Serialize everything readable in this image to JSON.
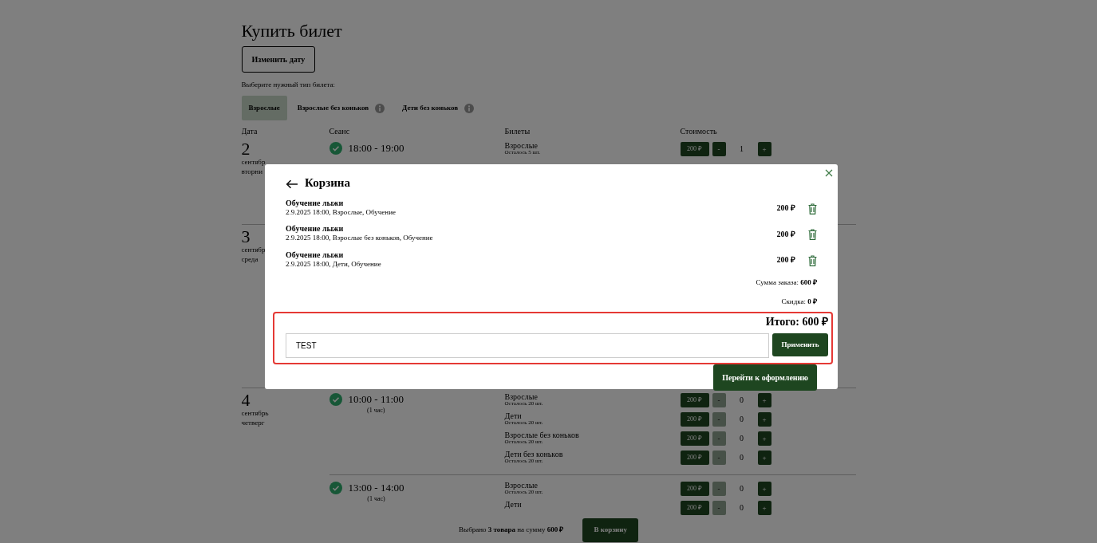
{
  "page": {
    "title": "Купить билет",
    "change_date_button": "Изменить дату",
    "instruction": "Выберите нужный тип билета:",
    "tabs": [
      {
        "label": "Взрослые",
        "selected": true,
        "info": false
      },
      {
        "label": "Взрослые без коньков",
        "selected": false,
        "info": true
      },
      {
        "label": "Дети без коньков",
        "selected": false,
        "info": true
      }
    ],
    "columns": [
      "Дата",
      "Сеанс",
      "Билеты",
      "Стоимость"
    ],
    "days": [
      {
        "day": "2",
        "month": "сентябр",
        "weekday": "вторни",
        "sessions": [
          {
            "time": "18:00 - 19:00",
            "tickets": [
              {
                "name": "Взрослые",
                "remaining": "Осталось 5 шт.",
                "price": "200 ₽",
                "minus": "-",
                "quantity": "1",
                "plus": "+",
                "minus_disabled": false
              }
            ]
          }
        ]
      },
      {
        "day": "3",
        "month": "сентябр",
        "weekday": "среда"
      },
      {
        "day": "4",
        "month": "сентябрь",
        "weekday": "четверг",
        "sessions": [
          {
            "time": "10:00 - 11:00",
            "duration": "(1 час)",
            "tickets": [
              {
                "name": "Взрослые",
                "remaining": "Осталось 20 шт.",
                "price": "200 ₽",
                "minus": "-",
                "quantity": "0",
                "plus": "+",
                "minus_disabled": true
              },
              {
                "name": "Дети",
                "remaining": "Осталось 20 шт.",
                "price": "200 ₽",
                "minus": "-",
                "quantity": "0",
                "plus": "+",
                "minus_disabled": true
              },
              {
                "name": "Взрослые без коньков",
                "remaining": "Осталось 20 шт.",
                "price": "200 ₽",
                "minus": "-",
                "quantity": "0",
                "plus": "+",
                "minus_disabled": true
              },
              {
                "name": "Дети без коньков",
                "remaining": "Осталось 20 шт.",
                "price": "200 ₽",
                "minus": "-",
                "quantity": "0",
                "plus": "+",
                "minus_disabled": true
              }
            ]
          },
          {
            "time": "13:00 - 14:00",
            "duration": "(1 час)",
            "tickets": [
              {
                "name": "Взрослые",
                "remaining": "Осталось 20 шт.",
                "price": "200 ₽",
                "minus": "-",
                "quantity": "0",
                "plus": "+",
                "minus_disabled": true
              },
              {
                "name": "Дети",
                "price": "200 ₽",
                "minus": "-",
                "quantity": "0",
                "plus": "+",
                "minus_disabled": true
              }
            ]
          }
        ]
      }
    ]
  },
  "bottom_bar": {
    "summary": "Выбрано **3 товара** на сумму **600  ₽**",
    "cart_button": "В корзину"
  },
  "cart_modal": {
    "title": "Корзина",
    "items": [
      {
        "name": "Обучение лыжи",
        "details": "2.9.2025 18:00, Взрослые, Обучение",
        "price": "200 ₽"
      },
      {
        "name": "Обучение лыжи",
        "details": "2.9.2025 18:00, Взрослые без коньков, Обучение",
        "price": "200 ₽"
      },
      {
        "name": "Обучение лыжи",
        "details": "2.9.2025 18:00, Дети, Обучение",
        "price": "200 ₽"
      }
    ],
    "subtotal": "Сумма заказа: **600 ₽**",
    "discount": "Скидка: **0 ₽**",
    "total": "Итого: 600 ₽",
    "coupon": {
      "value": "TEST",
      "apply_button": "Применить",
      "highlighted": true
    },
    "checkout_button": "Перейти к оформлению"
  }
}
